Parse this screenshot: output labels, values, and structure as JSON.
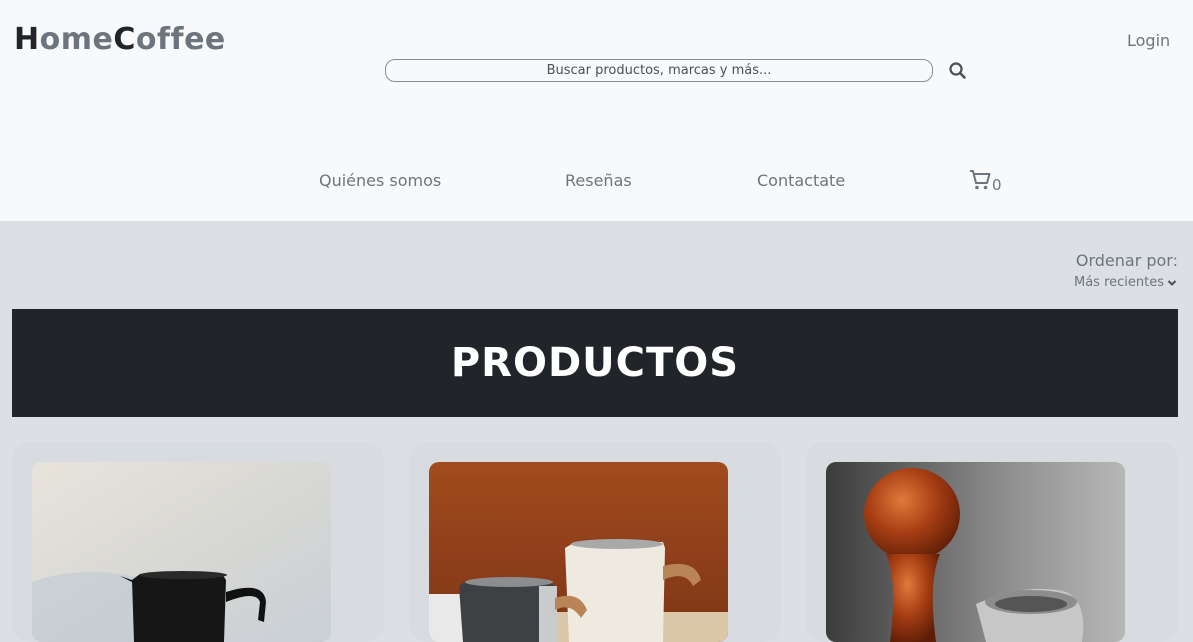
{
  "header": {
    "logo": {
      "h": "H",
      "ome": "ome",
      "c": "C",
      "offee": "offee"
    },
    "search": {
      "placeholder": "Buscar productos, marcas y más..."
    },
    "login_label": "Login",
    "nav": [
      {
        "label": "Quiénes somos"
      },
      {
        "label": "Reseñas"
      },
      {
        "label": "Contactate"
      }
    ],
    "cart_count": "0"
  },
  "sort": {
    "label": "Ordenar por:",
    "selected": "Más recientes"
  },
  "banner": {
    "title": "PRODUCTOS"
  },
  "colors": {
    "header_bg": "#f8f9fa",
    "page_bg": "#dcdfe3",
    "banner_bg": "#212529",
    "text_muted": "#6c757d"
  },
  "icons": [
    "search-icon",
    "cart-icon",
    "chevron-down-icon"
  ]
}
